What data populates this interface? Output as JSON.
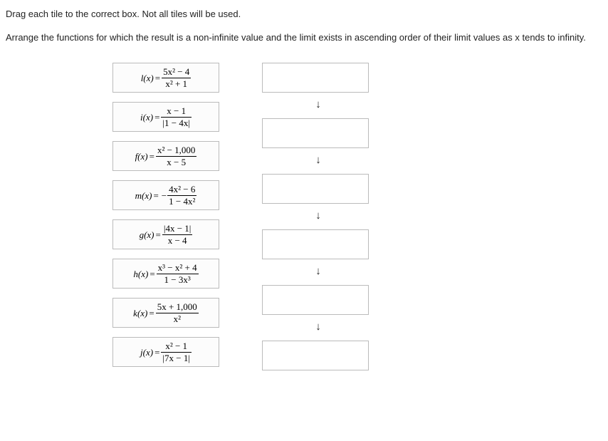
{
  "instructions": "Drag each tile to the correct box. Not all tiles will be used.",
  "prompt": "Arrange the functions for which the result is a non-infinite value and the limit exists in ascending order of their limit values as x tends to infinity.",
  "tiles": {
    "l": {
      "fn": "l(x)",
      "eq": "=",
      "neg": "",
      "num": "5x² − 4",
      "den": "x² + 1"
    },
    "i": {
      "fn": "i(x)",
      "eq": "=",
      "neg": "",
      "num": "x − 1",
      "den": "|1 − 4x|"
    },
    "f": {
      "fn": "f(x)",
      "eq": "=",
      "neg": "",
      "num": "x² − 1,000",
      "den": "x − 5"
    },
    "m": {
      "fn": "m(x)",
      "eq": "=",
      "neg": "−",
      "num": "4x² − 6",
      "den": "1 − 4x²"
    },
    "g": {
      "fn": "g(x)",
      "eq": "=",
      "neg": "",
      "num": "|4x − 1|",
      "den": "x − 4"
    },
    "h": {
      "fn": "h(x)",
      "eq": "=",
      "neg": "",
      "num": "x³ − x² + 4",
      "den": "1 − 3x³"
    },
    "k": {
      "fn": "k(x)",
      "eq": "=",
      "neg": "",
      "num": "5x + 1,000",
      "den": "x²"
    },
    "j": {
      "fn": "j(x)",
      "eq": "=",
      "neg": "",
      "num": "x² − 1",
      "den": "|7x − 1|"
    }
  },
  "arrows": {
    "a1": "↓",
    "a2": "↓",
    "a3": "↓",
    "a4": "↓",
    "a5": "↓"
  }
}
